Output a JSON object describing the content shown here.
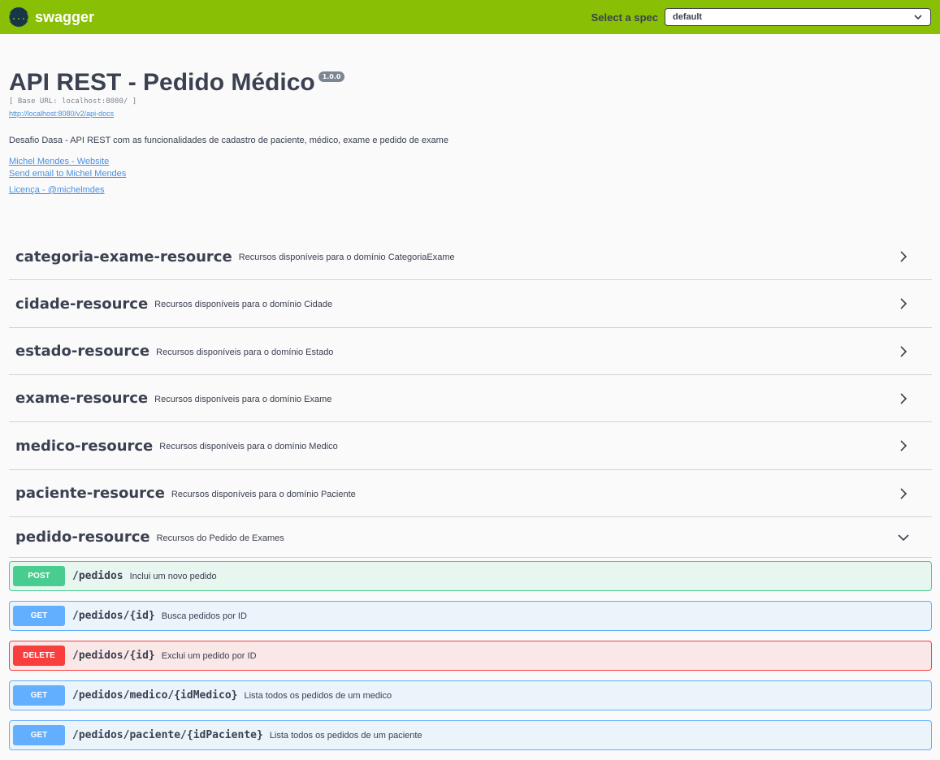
{
  "topbar": {
    "logo_glyph": "{...}",
    "logo_text": "swagger",
    "spec_label": "Select a spec",
    "spec_selected": "default"
  },
  "info": {
    "title": "API REST - Pedido Médico",
    "version": "1.0.0",
    "base_url": "[ Base URL: localhost:8080/ ]",
    "docs_link": "http://localhost:8080/v2/api-docs",
    "description": "Desafio Dasa - API REST com as funcionalidades de cadastro de paciente, médico, exame e pedido de exame",
    "website_link": "Michel Mendes - Website",
    "email_link": "Send email to Michel Mendes",
    "license_link": "Licença - @michelmdes"
  },
  "tags": [
    {
      "name": "categoria-exame-resource",
      "description": "Recursos disponíveis para o domínio CategoriaExame",
      "expanded": false
    },
    {
      "name": "cidade-resource",
      "description": "Recursos disponíveis para o domínio Cidade",
      "expanded": false
    },
    {
      "name": "estado-resource",
      "description": "Recursos disponíveis para o domínio Estado",
      "expanded": false
    },
    {
      "name": "exame-resource",
      "description": "Recursos disponíveis para o domínio Exame",
      "expanded": false
    },
    {
      "name": "medico-resource",
      "description": "Recursos disponíveis para o domínio Medico",
      "expanded": false
    },
    {
      "name": "paciente-resource",
      "description": "Recursos disponíveis para o domínio Paciente",
      "expanded": false
    },
    {
      "name": "pedido-resource",
      "description": "Recursos do Pedido de Exames",
      "expanded": true
    }
  ],
  "operations": [
    {
      "method": "POST",
      "path": "/pedidos",
      "summary": "Inclui um novo pedido"
    },
    {
      "method": "GET",
      "path": "/pedidos/{id}",
      "summary": "Busca pedidos por ID"
    },
    {
      "method": "DELETE",
      "path": "/pedidos/{id}",
      "summary": "Exclui um pedido por ID"
    },
    {
      "method": "GET",
      "path": "/pedidos/medico/{idMedico}",
      "summary": "Lista todos os pedidos de um medico"
    },
    {
      "method": "GET",
      "path": "/pedidos/paciente/{idPaciente}",
      "summary": "Lista todos os pedidos de um paciente"
    }
  ],
  "colors": {
    "topbar": "#89bf04",
    "post": "#49cc90",
    "get": "#61affe",
    "delete": "#f93e3e",
    "link": "#4990e2"
  }
}
